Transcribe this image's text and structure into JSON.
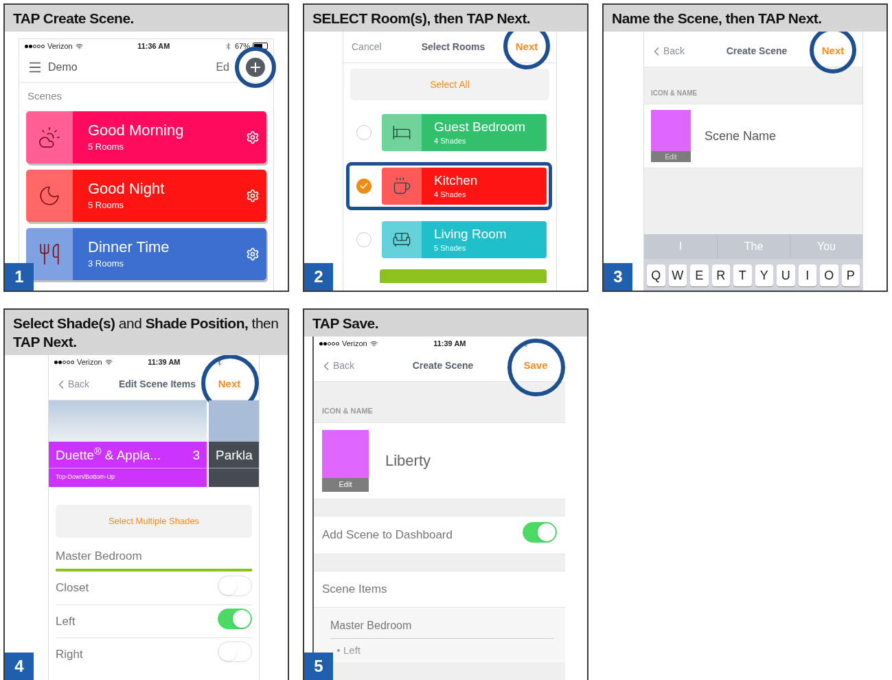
{
  "panels": [
    {
      "kind": "scenes",
      "number": "1",
      "title": "TAP Create Scene.",
      "status": {
        "carrier": "Verizon",
        "time": "11:36 AM",
        "battery": "67%"
      },
      "header": {
        "title": "Demo",
        "edit": "Ed"
      },
      "section": "Scenes",
      "scenes": [
        {
          "name": "Good Morning",
          "subtitle": "5 Rooms",
          "color": "#ff0a5c"
        },
        {
          "name": "Good Night",
          "subtitle": "5 Rooms",
          "color": "#ff1414"
        },
        {
          "name": "Dinner Time",
          "subtitle": "3 Rooms",
          "color": "#3d6fd1"
        }
      ]
    },
    {
      "kind": "rooms",
      "number": "2",
      "title": "SELECT Room(s), then TAP Next.",
      "nav": {
        "cancel": "Cancel",
        "title": "Select Rooms",
        "action": "Next"
      },
      "select_all": "Select All",
      "rooms": [
        {
          "name": "Guest Bedroom",
          "subtitle": "4 Shades",
          "color": "#33c16e",
          "selected": false
        },
        {
          "name": "Kitchen",
          "subtitle": "4 Shades",
          "color": "#ff1414",
          "selected": true
        },
        {
          "name": "Living Room",
          "subtitle": "5 Shades",
          "color": "#20bfcc",
          "selected": false
        }
      ]
    },
    {
      "kind": "name",
      "number": "3",
      "title": "Name the Scene, then TAP Next.",
      "nav": {
        "back": "Back",
        "title": "Create Scene",
        "action": "Next"
      },
      "section": "ICON & NAME",
      "icon_edit": "Edit",
      "placeholder": "Scene Name",
      "suggestions": [
        "I",
        "The",
        "You"
      ],
      "keys": [
        "Q",
        "W",
        "E",
        "R",
        "T",
        "Y",
        "U",
        "I",
        "O",
        "P"
      ]
    },
    {
      "kind": "shades",
      "number": "4",
      "title": "**Select Shade(s)** and **Shade Position,** then **TAP Next.**",
      "status": {
        "carrier": "Verizon",
        "time": "11:39 AM"
      },
      "nav": {
        "back": "Back",
        "title": "Edit Scene Items",
        "action": "Next"
      },
      "products": [
        {
          "name": "Duette$^{®}$ & Appla...",
          "count": "3",
          "subtitle": "Top-Down/Bottom-Up",
          "selected": true
        },
        {
          "name": "Parkla",
          "selected": false
        }
      ],
      "select_multiple": "Select Multiple Shades",
      "room": "Master Bedroom",
      "shades": [
        {
          "name": "Closet",
          "on": false
        },
        {
          "name": "Left",
          "on": true
        },
        {
          "name": "Right",
          "on": false
        }
      ]
    },
    {
      "kind": "save",
      "number": "5",
      "title": "TAP Save.",
      "status": {
        "carrier": "Verizon",
        "time": "11:39 AM"
      },
      "nav": {
        "back": "Back",
        "title": "Create Scene",
        "action": "Save"
      },
      "section": "ICON & NAME",
      "icon_edit": "Edit",
      "name": "Liberty",
      "dashboard": {
        "label": "Add Scene to Dashboard",
        "on": true
      },
      "items_label": "Scene Items",
      "room": "Master Bedroom",
      "items": [
        "Left"
      ]
    }
  ]
}
